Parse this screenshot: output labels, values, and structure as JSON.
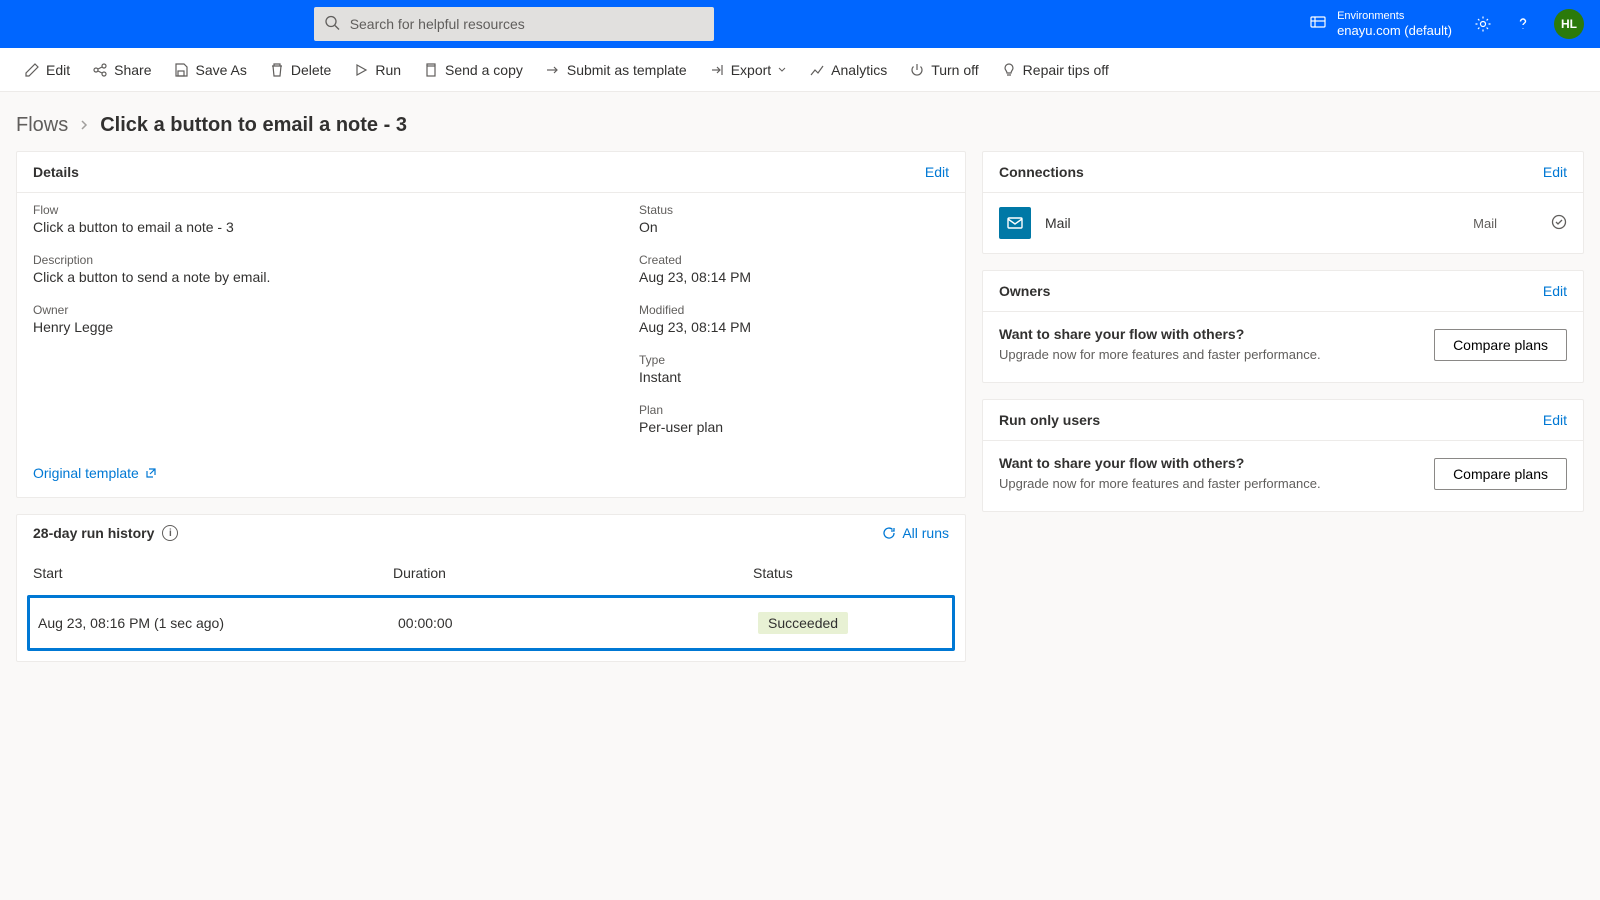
{
  "search": {
    "placeholder": "Search for helpful resources"
  },
  "env": {
    "label": "Environments",
    "name": "enayu.com (default)"
  },
  "avatar": "HL",
  "cmdbar": {
    "edit": "Edit",
    "share": "Share",
    "saveas": "Save As",
    "delete": "Delete",
    "run": "Run",
    "sendcopy": "Send a copy",
    "submit": "Submit as template",
    "export": "Export",
    "analytics": "Analytics",
    "turnoff": "Turn off",
    "repair": "Repair tips off"
  },
  "breadcrumb": {
    "root": "Flows",
    "current": "Click a button to email a note - 3"
  },
  "details": {
    "title": "Details",
    "edit": "Edit",
    "flow_lbl": "Flow",
    "flow_val": "Click a button to email a note - 3",
    "desc_lbl": "Description",
    "desc_val": "Click a button to send a note by email.",
    "owner_lbl": "Owner",
    "owner_val": "Henry Legge",
    "status_lbl": "Status",
    "status_val": "On",
    "created_lbl": "Created",
    "created_val": "Aug 23, 08:14 PM",
    "modified_lbl": "Modified",
    "modified_val": "Aug 23, 08:14 PM",
    "type_lbl": "Type",
    "type_val": "Instant",
    "plan_lbl": "Plan",
    "plan_val": "Per-user plan",
    "orig_tpl": "Original template"
  },
  "runhist": {
    "title": "28-day run history",
    "allruns": "All runs",
    "cols": {
      "start": "Start",
      "duration": "Duration",
      "status": "Status"
    },
    "row": {
      "start": "Aug 23, 08:16 PM (1 sec ago)",
      "duration": "00:00:00",
      "status": "Succeeded"
    }
  },
  "connections": {
    "title": "Connections",
    "edit": "Edit",
    "name": "Mail",
    "type": "Mail"
  },
  "owners": {
    "title": "Owners",
    "edit": "Edit",
    "upsell_title": "Want to share your flow with others?",
    "upsell_sub": "Upgrade now for more features and faster performance.",
    "btn": "Compare plans"
  },
  "runonly": {
    "title": "Run only users",
    "edit": "Edit",
    "upsell_title": "Want to share your flow with others?",
    "upsell_sub": "Upgrade now for more features and faster performance.",
    "btn": "Compare plans"
  }
}
